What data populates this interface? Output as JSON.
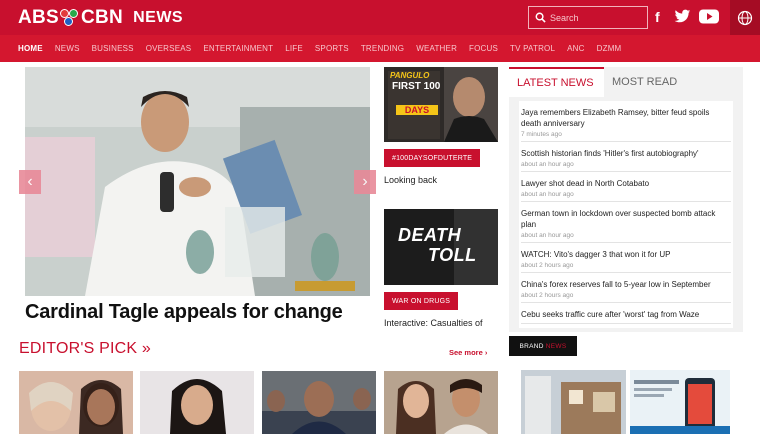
{
  "header": {
    "logo_text_left": "ABS",
    "logo_text_right": "CBN",
    "logo_news": "NEWS",
    "search_placeholder": "Search",
    "social_icons": [
      "facebook-icon",
      "twitter-icon",
      "youtube-icon"
    ],
    "accent_color": "#c8102e"
  },
  "nav": {
    "items": [
      "HOME",
      "NEWS",
      "BUSINESS",
      "OVERSEAS",
      "ENTERTAINMENT",
      "LIFE",
      "SPORTS",
      "TRENDING",
      "WEATHER",
      "FOCUS",
      "TV PATROL",
      "ANC",
      "DZMM"
    ]
  },
  "hero": {
    "title": "Cardinal Tagle appeals for change"
  },
  "middle": {
    "story1": {
      "image_text_top": "PANGULO",
      "image_text_big": "FIRST 100",
      "image_text_days": "DAYS",
      "tag": "#100DAYSOFDUTERTE",
      "headline": "Looking back"
    },
    "story2": {
      "image_text_1": "DEATH",
      "image_text_2": "TOLL",
      "tag": "WAR ON DRUGS",
      "headline": "Interactive: Casualties of"
    }
  },
  "latest": {
    "tab_latest": "LATEST NEWS",
    "tab_most_read": "MOST READ",
    "items": [
      {
        "headline": "Jaya remembers Elizabeth Ramsey, bitter feud spoils death anniversary",
        "time": "7 minutes ago"
      },
      {
        "headline": "Scottish historian finds 'Hitler's first autobiography'",
        "time": "about an hour ago"
      },
      {
        "headline": "Lawyer shot dead in North Cotabato",
        "time": "about an hour ago"
      },
      {
        "headline": "German town in lockdown over suspected bomb attack plan",
        "time": "about an hour ago"
      },
      {
        "headline": "WATCH: Vito's dagger 3 that won it for UP",
        "time": "about 2 hours ago"
      },
      {
        "headline": "China's forex reserves fall to 5-year low in September",
        "time": "about 2 hours ago"
      },
      {
        "headline": "Cebu seeks traffic cure after 'worst' tag from Waze",
        "time": ""
      }
    ]
  },
  "brand": {
    "label": "BRAND",
    "label_accent": "NEWS"
  },
  "editors_pick": {
    "title": "EDITOR'S PICK »",
    "see_more": "See more ›"
  }
}
